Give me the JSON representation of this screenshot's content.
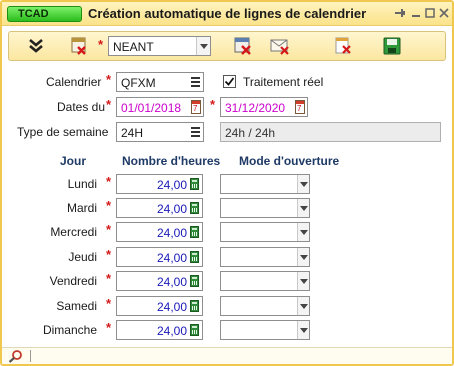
{
  "window": {
    "badge": "TCAD",
    "title": "Création automatique de lignes de calendrier"
  },
  "toolbar": {
    "template_select_value": "NEANT",
    "buttons": [
      {
        "name": "expand-down-icon"
      },
      {
        "name": "generate-icon"
      },
      {
        "name": "delete-calendar-icon"
      },
      {
        "name": "mail-delete-icon"
      },
      {
        "name": "clear-icon"
      },
      {
        "name": "save-icon"
      }
    ]
  },
  "form": {
    "calendrier_label": "Calendrier",
    "calendrier_value": "QFXM",
    "traitement_reel_label": "Traitement réel",
    "traitement_reel_checked": true,
    "dates_label": "Dates du",
    "date_from": "01/01/2018",
    "date_to": "31/12/2020",
    "type_semaine_label": "Type de semaine",
    "type_semaine_value": "24H",
    "type_semaine_desc": "24h / 24h"
  },
  "table": {
    "col_jour": "Jour",
    "col_heures": "Nombre d'heures",
    "col_mode": "Mode d'ouverture",
    "rows": [
      {
        "day": "Lundi",
        "hours": "24,00",
        "mode": ""
      },
      {
        "day": "Mardi",
        "hours": "24,00",
        "mode": ""
      },
      {
        "day": "Mercredi",
        "hours": "24,00",
        "mode": ""
      },
      {
        "day": "Jeudi",
        "hours": "24,00",
        "mode": ""
      },
      {
        "day": "Vendredi",
        "hours": "24,00",
        "mode": ""
      },
      {
        "day": "Samedi",
        "hours": "24,00",
        "mode": ""
      },
      {
        "day": "Dimanche",
        "hours": "24,00",
        "mode": ""
      }
    ]
  },
  "colors": {
    "required": "#d51818",
    "date_text": "#cc00cc",
    "hours_text": "#1a1ab8",
    "header_text": "#1f3a66",
    "badge": "#2bbd1d"
  }
}
